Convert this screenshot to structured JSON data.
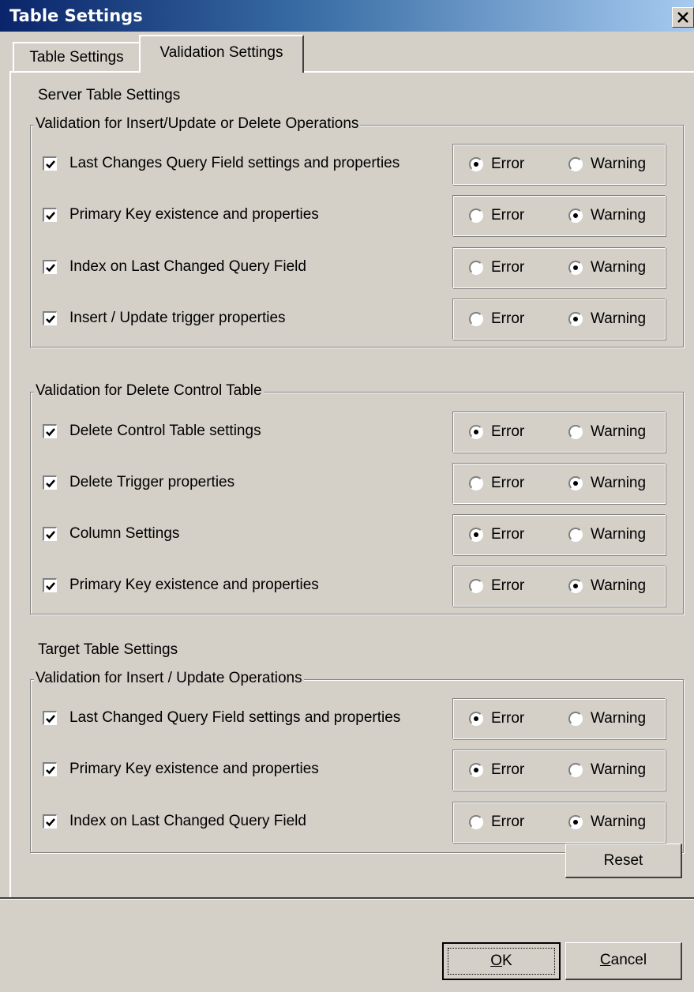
{
  "window": {
    "title": "Table Settings"
  },
  "tabs": [
    {
      "label": "Table Settings",
      "selected": false
    },
    {
      "label": "Validation Settings",
      "selected": true
    }
  ],
  "server_section": {
    "label": "Server Table Settings"
  },
  "target_section": {
    "label": "Target Table Settings"
  },
  "radio_labels": {
    "error": "Error",
    "warning": "Warning"
  },
  "groups": [
    {
      "title": "Validation for Insert/Update or Delete Operations",
      "rows": [
        {
          "label": "Last Changes Query Field settings and properties",
          "checked": true,
          "selected": "error"
        },
        {
          "label": "Primary Key existence and properties",
          "checked": true,
          "selected": "warning"
        },
        {
          "label": "Index on Last Changed Query Field",
          "checked": true,
          "selected": "warning"
        },
        {
          "label": "Insert / Update trigger properties",
          "checked": true,
          "selected": "warning"
        }
      ]
    },
    {
      "title": "Validation for Delete Control Table",
      "rows": [
        {
          "label": "Delete Control Table settings",
          "checked": true,
          "selected": "error"
        },
        {
          "label": "Delete Trigger properties",
          "checked": true,
          "selected": "warning"
        },
        {
          "label": "Column Settings",
          "checked": true,
          "selected": "error"
        },
        {
          "label": "Primary Key existence and properties",
          "checked": true,
          "selected": "warning"
        }
      ]
    },
    {
      "title": "Validation for Insert / Update Operations",
      "rows": [
        {
          "label": "Last Changed Query Field settings and properties",
          "checked": true,
          "selected": "error"
        },
        {
          "label": "Primary Key existence and properties",
          "checked": true,
          "selected": "error"
        },
        {
          "label": "Index on Last Changed Query Field",
          "checked": true,
          "selected": "warning"
        }
      ]
    }
  ],
  "buttons": {
    "reset": "Reset",
    "ok_mnemonic": "O",
    "ok_rest": "K",
    "cancel_mnemonic": "C",
    "cancel_rest": "ancel"
  }
}
